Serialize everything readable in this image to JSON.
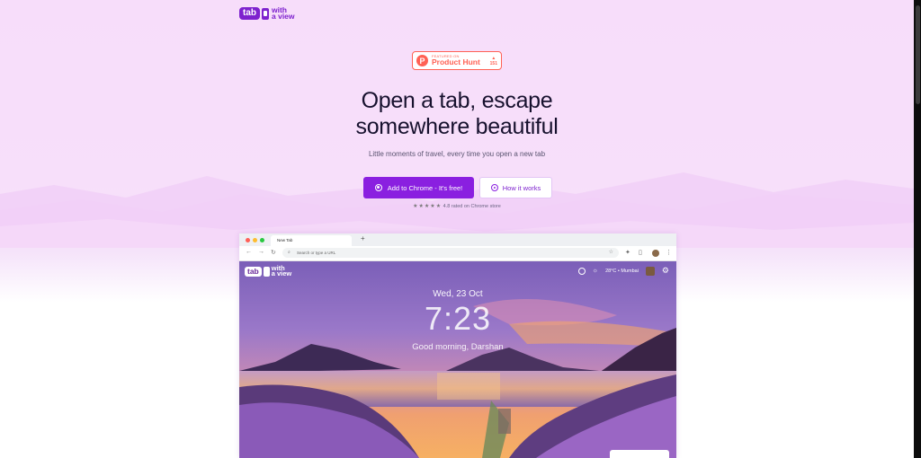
{
  "logo": {
    "tab": "tab",
    "with": "with",
    "a_view": "a view"
  },
  "product_hunt": {
    "featured_on": "FEATURED ON",
    "name": "Product Hunt",
    "votes": "151"
  },
  "hero": {
    "title_line1": "Open a tab, escape",
    "title_line2": "somewhere beautiful",
    "subtitle": "Little moments of travel, every time you open a new tab"
  },
  "cta": {
    "primary": "Add to Chrome - It's free!",
    "secondary": "How it works",
    "stars": "★★★★★",
    "rating_text": "4.8 rated on Chrome store"
  },
  "browser": {
    "tab_title": "New Tab",
    "new_tab_symbol": "+",
    "address_placeholder": "Search or type a URL"
  },
  "newtab_preview": {
    "weather": "28°C • Mumbai",
    "date": "Wed, 23 Oct",
    "time": "7:23",
    "greeting": "Good morning, Darshan"
  },
  "colors": {
    "brand": "#8a1fe0",
    "product_hunt": "#ff6154",
    "background_top": "#f7ddfa"
  }
}
